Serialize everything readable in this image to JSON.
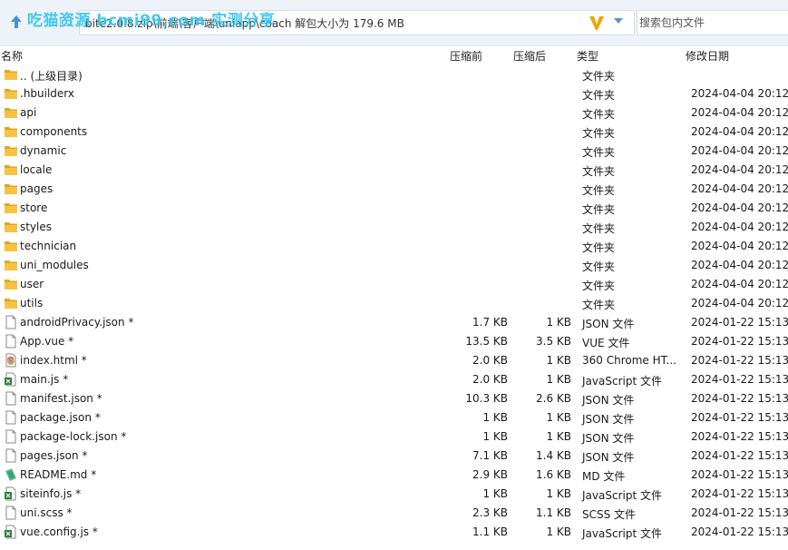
{
  "toolbar": {
    "watermark": "吃猫资源 bcmi99.com 实测分享",
    "address": "bite2.0.8.zip\\前端\\客户端\\uniapp\\coach   解包大小为 179.6 MB",
    "search_placeholder": "搜索包内文件"
  },
  "columns": {
    "name": "名称",
    "size": "压缩前",
    "packed": "压缩后",
    "type": "类型",
    "modified": "修改日期"
  },
  "colors": {
    "folder": "#f5c342",
    "folder_dark": "#e3a51f",
    "toolbar_bg": "#eef3fa",
    "watermark": "#33c6ef",
    "v_icon": "#f0a500",
    "dropdown": "#5b8fd0"
  },
  "rows": [
    {
      "icon": "folder-icon",
      "name": ".. (上级目录)",
      "size": "",
      "packed": "",
      "type": "文件夹",
      "modified": ""
    },
    {
      "icon": "folder-icon",
      "name": ".hbuilderx",
      "size": "",
      "packed": "",
      "type": "文件夹",
      "modified": "2024-04-04 20:12"
    },
    {
      "icon": "folder-icon",
      "name": "api",
      "size": "",
      "packed": "",
      "type": "文件夹",
      "modified": "2024-04-04 20:12"
    },
    {
      "icon": "folder-icon",
      "name": "components",
      "size": "",
      "packed": "",
      "type": "文件夹",
      "modified": "2024-04-04 20:12"
    },
    {
      "icon": "folder-icon",
      "name": "dynamic",
      "size": "",
      "packed": "",
      "type": "文件夹",
      "modified": "2024-04-04 20:12"
    },
    {
      "icon": "folder-icon",
      "name": "locale",
      "size": "",
      "packed": "",
      "type": "文件夹",
      "modified": "2024-04-04 20:12"
    },
    {
      "icon": "folder-icon",
      "name": "pages",
      "size": "",
      "packed": "",
      "type": "文件夹",
      "modified": "2024-04-04 20:12"
    },
    {
      "icon": "folder-icon",
      "name": "store",
      "size": "",
      "packed": "",
      "type": "文件夹",
      "modified": "2024-04-04 20:12"
    },
    {
      "icon": "folder-icon",
      "name": "styles",
      "size": "",
      "packed": "",
      "type": "文件夹",
      "modified": "2024-04-04 20:12"
    },
    {
      "icon": "folder-icon",
      "name": "technician",
      "size": "",
      "packed": "",
      "type": "文件夹",
      "modified": "2024-04-04 20:12"
    },
    {
      "icon": "folder-icon",
      "name": "uni_modules",
      "size": "",
      "packed": "",
      "type": "文件夹",
      "modified": "2024-04-04 20:12"
    },
    {
      "icon": "folder-icon",
      "name": "user",
      "size": "",
      "packed": "",
      "type": "文件夹",
      "modified": "2024-04-04 20:12"
    },
    {
      "icon": "folder-icon",
      "name": "utils",
      "size": "",
      "packed": "",
      "type": "文件夹",
      "modified": "2024-04-04 20:12"
    },
    {
      "icon": "file-icon",
      "name": "androidPrivacy.json *",
      "size": "1.7 KB",
      "packed": "1 KB",
      "type": "JSON 文件",
      "modified": "2024-01-22 15:13"
    },
    {
      "icon": "file-icon",
      "name": "App.vue *",
      "size": "13.5 KB",
      "packed": "3.5 KB",
      "type": "VUE 文件",
      "modified": "2024-01-22 15:13"
    },
    {
      "icon": "html-icon",
      "name": "index.html *",
      "size": "2.0 KB",
      "packed": "1 KB",
      "type": "360 Chrome HT...",
      "modified": "2024-01-22 15:13"
    },
    {
      "icon": "js-icon",
      "name": "main.js *",
      "size": "2.0 KB",
      "packed": "1 KB",
      "type": "JavaScript 文件",
      "modified": "2024-01-22 15:13"
    },
    {
      "icon": "file-icon",
      "name": "manifest.json *",
      "size": "10.3 KB",
      "packed": "2.6 KB",
      "type": "JSON 文件",
      "modified": "2024-01-22 15:13"
    },
    {
      "icon": "file-icon",
      "name": "package.json *",
      "size": "1 KB",
      "packed": "1 KB",
      "type": "JSON 文件",
      "modified": "2024-01-22 15:13"
    },
    {
      "icon": "file-icon",
      "name": "package-lock.json *",
      "size": "1 KB",
      "packed": "1 KB",
      "type": "JSON 文件",
      "modified": "2024-01-22 15:13"
    },
    {
      "icon": "file-icon",
      "name": "pages.json *",
      "size": "7.1 KB",
      "packed": "1.4 KB",
      "type": "JSON 文件",
      "modified": "2024-01-22 15:13"
    },
    {
      "icon": "md-icon",
      "name": "README.md *",
      "size": "2.9 KB",
      "packed": "1.6 KB",
      "type": "MD 文件",
      "modified": "2024-01-22 15:13"
    },
    {
      "icon": "js-icon",
      "name": "siteinfo.js *",
      "size": "1 KB",
      "packed": "1 KB",
      "type": "JavaScript 文件",
      "modified": "2024-01-22 15:13"
    },
    {
      "icon": "file-icon",
      "name": "uni.scss *",
      "size": "2.3 KB",
      "packed": "1.1 KB",
      "type": "SCSS 文件",
      "modified": "2024-01-22 15:13"
    },
    {
      "icon": "js-icon",
      "name": "vue.config.js *",
      "size": "1.1 KB",
      "packed": "1 KB",
      "type": "JavaScript 文件",
      "modified": "2024-01-22 15:13"
    }
  ]
}
